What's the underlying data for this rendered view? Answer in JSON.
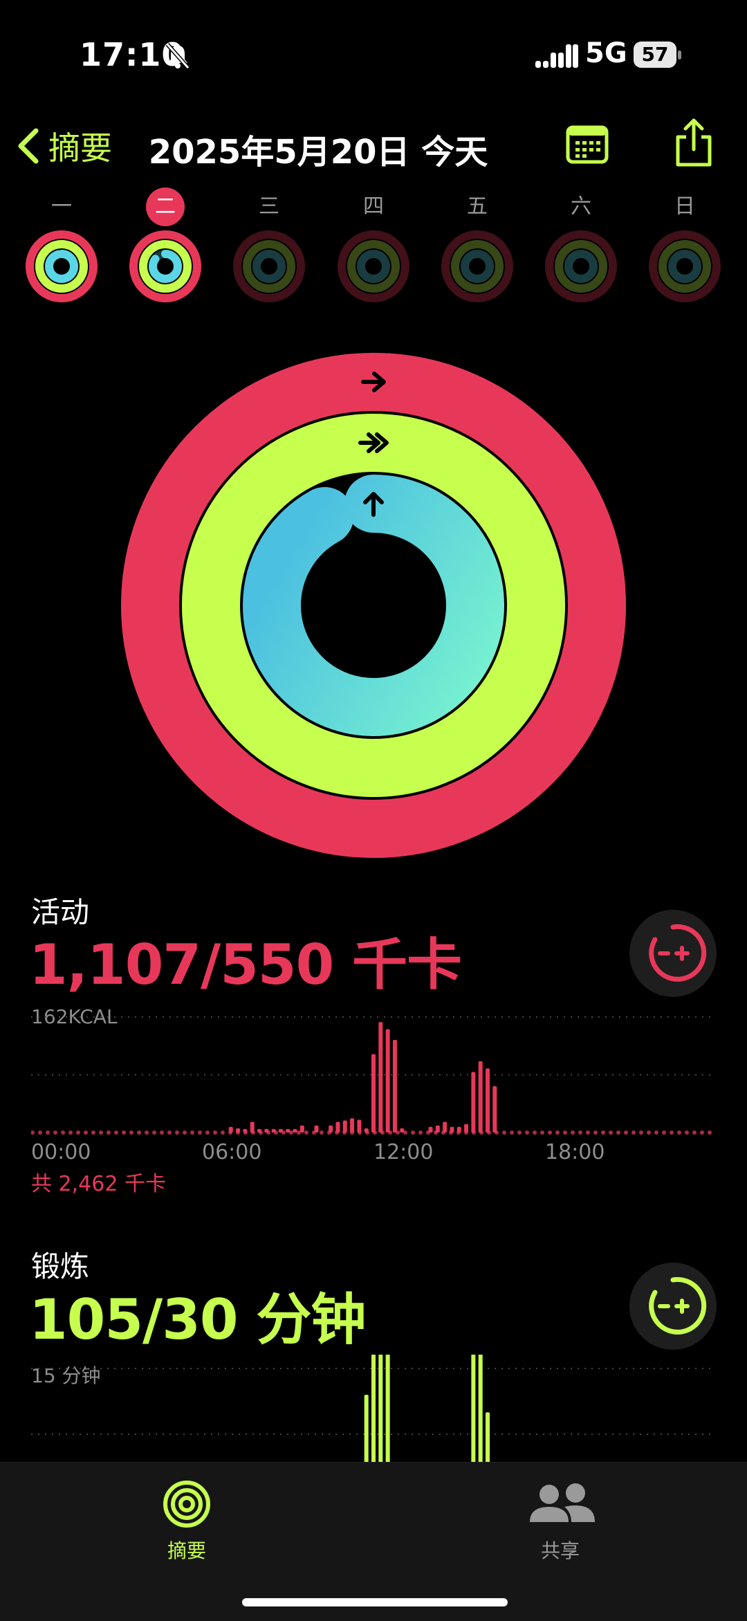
{
  "status": {
    "time": "17:10",
    "network": "5G",
    "battery": "57"
  },
  "header": {
    "back_label": "摘要",
    "title": "2025年5月20日 今天"
  },
  "week": [
    {
      "label": "一",
      "today": false,
      "move": 1.0,
      "exercise": 1.0,
      "stand": 0.95
    },
    {
      "label": "二",
      "today": true,
      "move": 1.0,
      "exercise": 1.0,
      "stand": 0.85
    },
    {
      "label": "三",
      "today": false,
      "move": 0,
      "exercise": 0,
      "stand": 0
    },
    {
      "label": "四",
      "today": false,
      "move": 0,
      "exercise": 0,
      "stand": 0
    },
    {
      "label": "五",
      "today": false,
      "move": 0,
      "exercise": 0,
      "stand": 0
    },
    {
      "label": "六",
      "today": false,
      "move": 0,
      "exercise": 0,
      "stand": 0
    },
    {
      "label": "日",
      "today": false,
      "move": 0,
      "exercise": 0,
      "stand": 0
    }
  ],
  "rings": {
    "move_progress": 2.01,
    "exercise_progress": 3.5,
    "stand_progress": 0.92,
    "colors": {
      "move": "#e8385a",
      "exercise": "#c6ff4d",
      "stand": "#5ad6e6"
    }
  },
  "activity": {
    "title": "活动",
    "value": "1,107/550 千卡",
    "color": "#e8385a",
    "chart_label": "162KCAL",
    "total": "共 2,462 千卡"
  },
  "exercise": {
    "title": "锻炼",
    "value": "105/30 分钟",
    "color": "#c6ff4d",
    "chart_label": "15 分钟"
  },
  "axis": [
    "00:00",
    "06:00",
    "12:00",
    "18:00"
  ],
  "chart_data": [
    {
      "type": "bar",
      "ymax": 162,
      "x_hours": [
        7.0,
        7.25,
        7.5,
        7.75,
        8.0,
        8.25,
        8.5,
        8.75,
        9.0,
        9.25,
        9.5,
        10.0,
        10.5,
        10.75,
        11.0,
        11.25,
        11.5,
        11.75,
        12.0,
        12.25,
        12.5,
        12.75,
        13.0,
        14.0,
        14.25,
        14.5,
        14.75,
        15.0,
        15.25,
        15.5,
        15.75,
        16.0,
        16.25
      ],
      "values": [
        8,
        6,
        5,
        15,
        5,
        5,
        5,
        5,
        5,
        5,
        10,
        10,
        10,
        15,
        17,
        20,
        18,
        6,
        110,
        155,
        145,
        130,
        6,
        8,
        10,
        15,
        8,
        8,
        12,
        85,
        100,
        90,
        65
      ]
    },
    {
      "type": "bar",
      "ymax": 15,
      "x_hours": [
        11.75,
        12.0,
        12.25,
        12.5,
        15.5,
        15.75,
        16.0
      ],
      "values": [
        12,
        18,
        18,
        17,
        18,
        18,
        10
      ]
    }
  ],
  "tabs": [
    {
      "label": "摘要",
      "active": true
    },
    {
      "label": "共享",
      "active": false
    }
  ]
}
